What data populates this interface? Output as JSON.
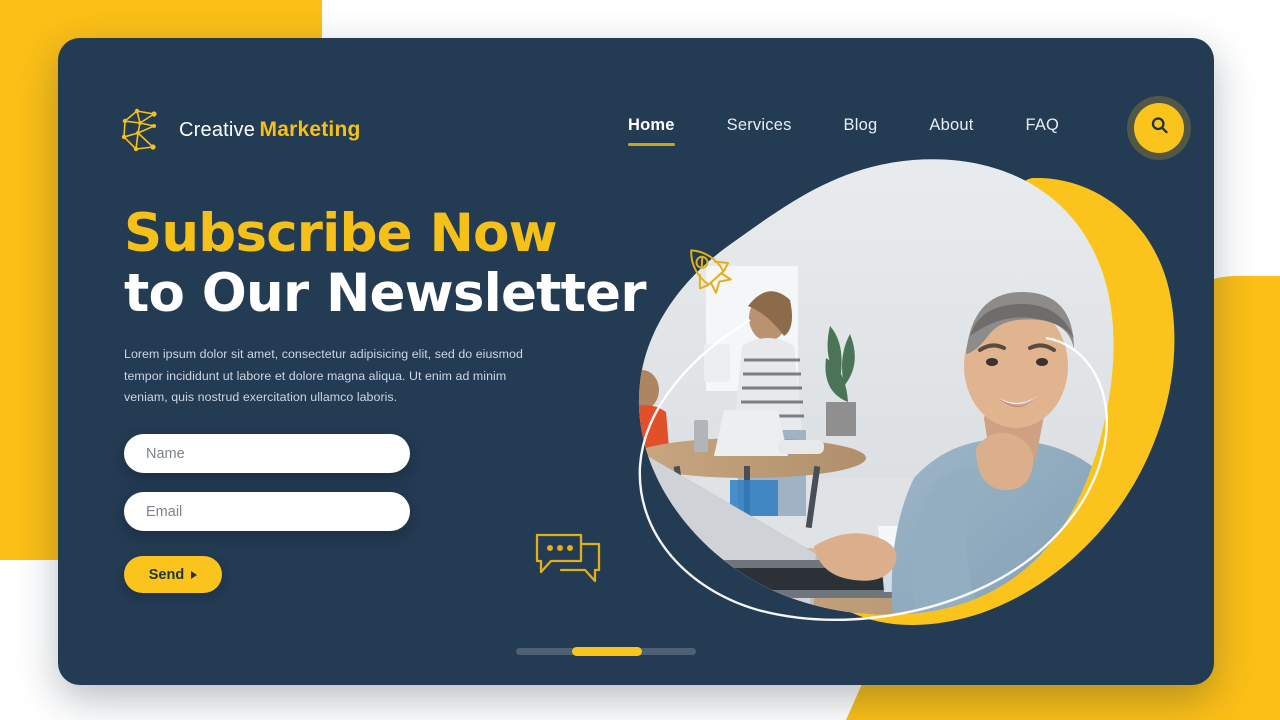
{
  "brand": {
    "logo_icon": "network-c-logo-icon",
    "name_line1": "Creative",
    "name_line2": "Marketing"
  },
  "nav": {
    "items": [
      {
        "label": "Home",
        "active": true
      },
      {
        "label": "Services",
        "active": false
      },
      {
        "label": "Blog",
        "active": false
      },
      {
        "label": "About",
        "active": false
      },
      {
        "label": "FAQ",
        "active": false
      }
    ],
    "search_icon": "search-icon"
  },
  "hero": {
    "headline_line1": "Subscribe Now",
    "headline_line2": "to Our Newsletter",
    "paragraph": "Lorem ipsum dolor sit amet, consectetur adipisicing elit, sed do eiusmod tempor incididunt ut labore et dolore magna aliqua. Ut enim ad minim veniam, quis nostrud exercitation ullamco laboris.",
    "form": {
      "name_placeholder": "Name",
      "name_value": "",
      "email_placeholder": "Email",
      "email_value": "",
      "submit_label": "Send"
    },
    "decorations": {
      "rocket_icon": "rocket-icon",
      "chat_icon": "chat-bubbles-icon"
    },
    "image_alt": "Smiling man in denim shirt working at a laptop in a bright office"
  },
  "slider": {
    "total_slides": 3,
    "active_slide": 2
  },
  "colors": {
    "card_background": "#233B53",
    "accent_yellow": "#FBC41C",
    "headline_yellow": "#F5C119",
    "underline_yellow": "#C9A518",
    "text_white": "#FFFFFF",
    "body_text": "#CDD6DF",
    "slider_track": "#4E6073",
    "page_background": "#FFFFFF"
  }
}
